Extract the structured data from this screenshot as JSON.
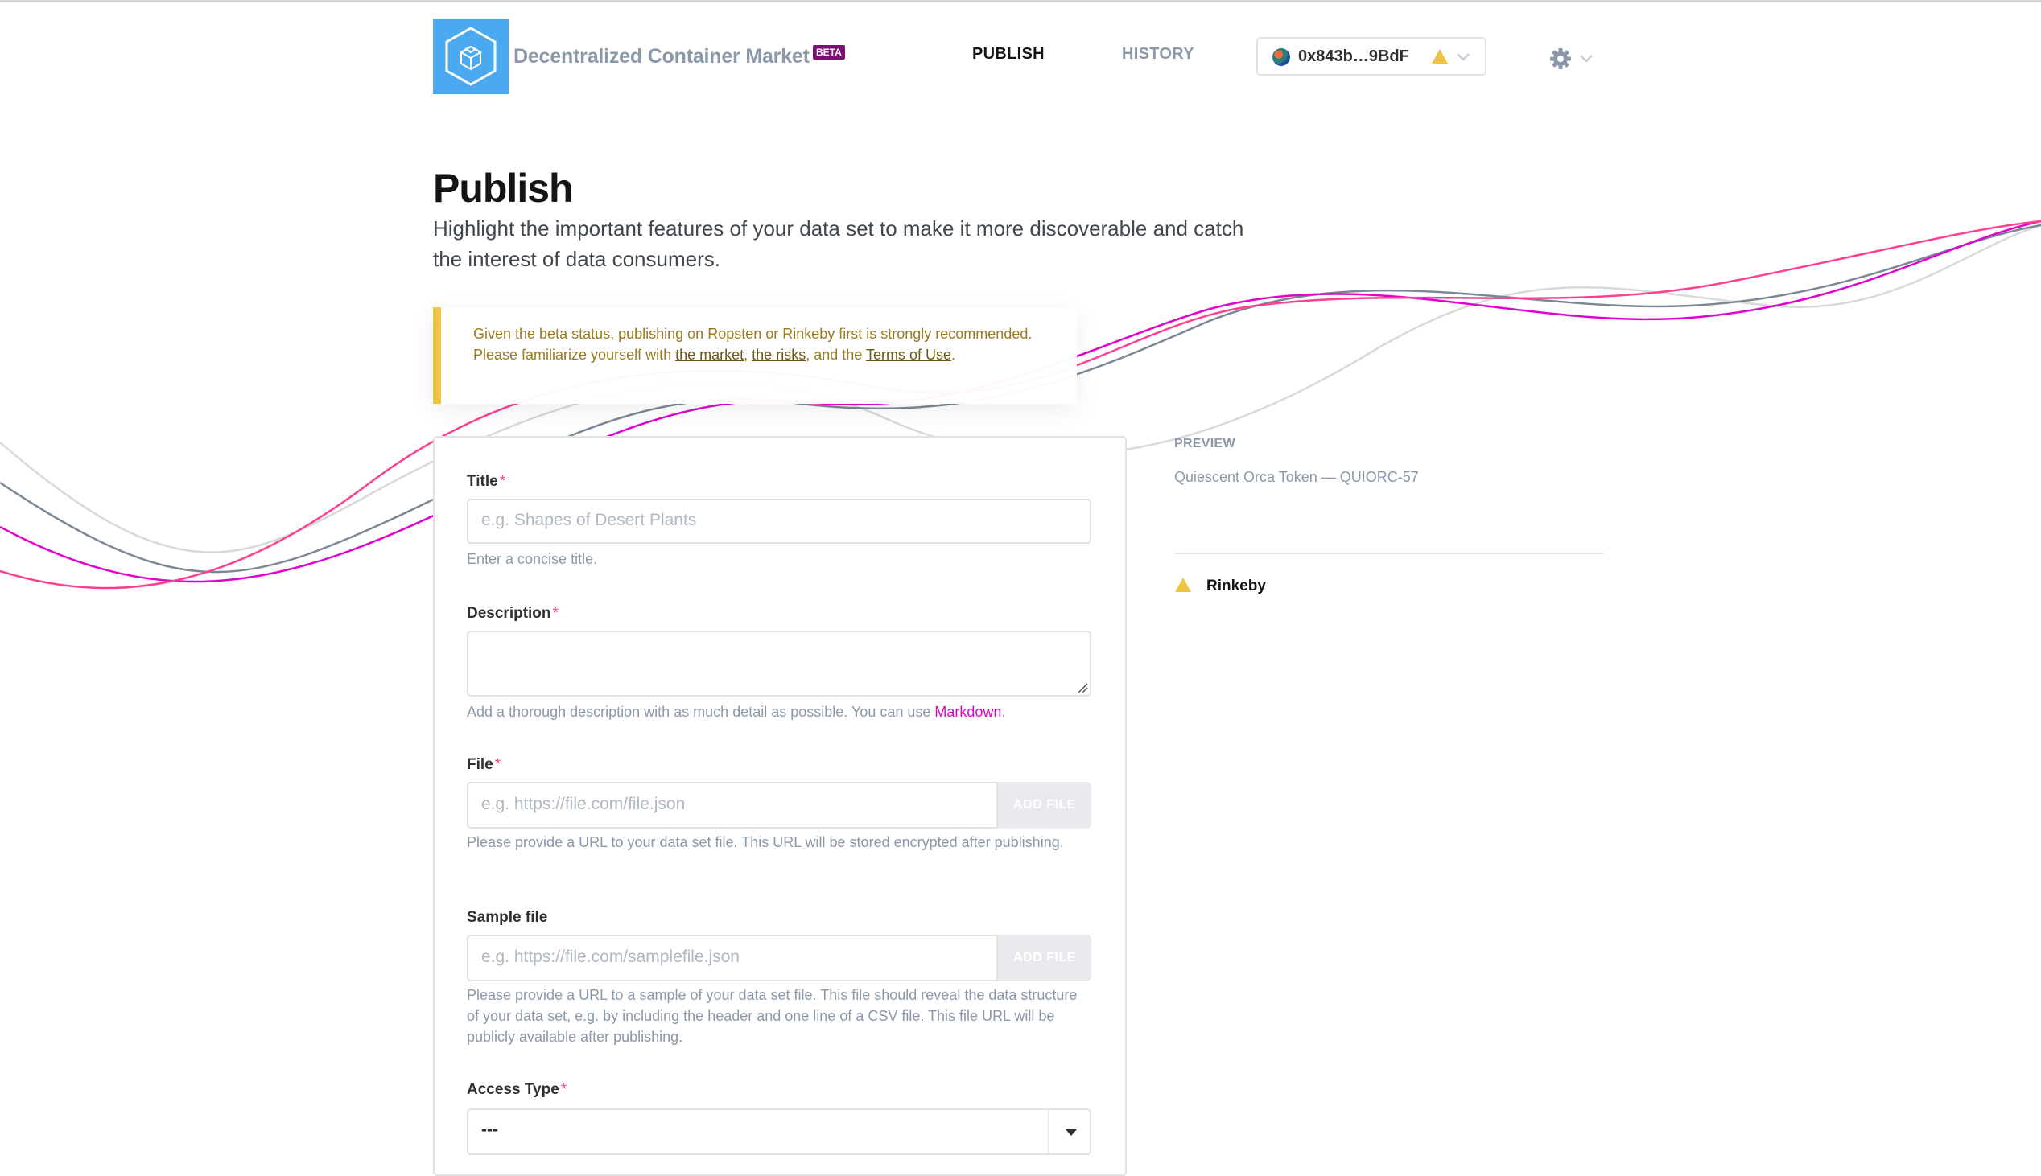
{
  "header": {
    "brand": "Decentralized Container Market",
    "beta_badge": "BETA",
    "nav": [
      {
        "label": "PUBLISH",
        "active": true
      },
      {
        "label": "HISTORY",
        "active": false
      }
    ],
    "wallet": {
      "address": "0x843b…9BdF",
      "network_warning_icon": "warning-triangle-icon"
    },
    "settings_icon": "gear-icon"
  },
  "page": {
    "title": "Publish",
    "lead": "Highlight the important features of your data set to make it more discoverable and catch the interest of data consumers."
  },
  "notice": {
    "text_before": "Given the beta status, publishing on Ropsten or Rinkeby first is strongly recommended. Please familiarize yourself with ",
    "link_market": "the market",
    "sep1": ", ",
    "link_risks": "the risks",
    "sep2": ", and the ",
    "link_terms": "Terms of Use",
    "end": "."
  },
  "form": {
    "title": {
      "label": "Title",
      "required_mark": "*",
      "placeholder": "e.g. Shapes of Desert Plants",
      "value": "",
      "help": "Enter a concise title."
    },
    "description": {
      "label": "Description",
      "required_mark": "*",
      "value": "",
      "help_text": "Add a thorough description with as much detail as possible. You can use ",
      "help_link": "Markdown",
      "help_end": "."
    },
    "file": {
      "label": "File",
      "required_mark": "*",
      "placeholder": "e.g. https://file.com/file.json",
      "button": "ADD FILE",
      "help": "Please provide a URL to your data set file. This URL will be stored encrypted after publishing."
    },
    "sample_file": {
      "label": "Sample file",
      "placeholder": "e.g. https://file.com/samplefile.json",
      "button": "ADD FILE",
      "help": "Please provide a URL to a sample of your data set file. This file should reveal the data structure of your data set, e.g. by including the header and one line of a CSV file. This file URL will be publicly available after publishing."
    },
    "access_type": {
      "label": "Access Type",
      "required_mark": "*",
      "selected": "---"
    }
  },
  "preview": {
    "label": "PREVIEW",
    "title": "Quiescent Orca Token — QUIORC-57",
    "network": "Rinkeby"
  },
  "colors": {
    "logo_tile": "#4aa9ef",
    "brand_text": "#8b98a9",
    "beta_badge": "#7b1173",
    "pink_accent": "#ff4092",
    "warning": "#eec443",
    "link_magenta": "#e000cf"
  }
}
